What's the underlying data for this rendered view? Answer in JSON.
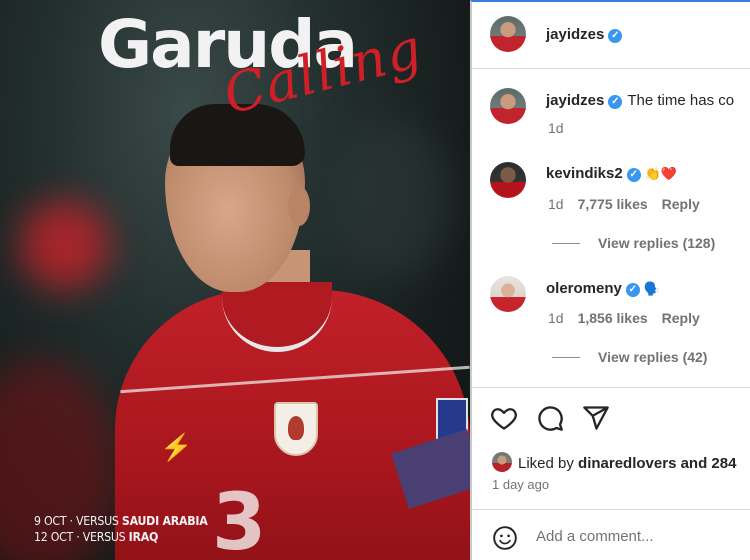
{
  "poster": {
    "title": "Garuda",
    "script": "Calling",
    "shirt_number": "3",
    "fixtures": [
      {
        "date": "9 OCT",
        "prefix": "VERSUS",
        "opponent": "SAUDI ARABIA"
      },
      {
        "date": "12 OCT",
        "prefix": "VERSUS",
        "opponent": "IRAQ"
      }
    ]
  },
  "header": {
    "username": "jayidzes"
  },
  "caption": {
    "username": "jayidzes",
    "text": "The time has co",
    "time": "1d"
  },
  "comments": [
    {
      "username": "kevindiks2",
      "emoji": "👏❤️",
      "time": "1d",
      "likes": "7,775 likes",
      "reply_label": "Reply",
      "view_replies": "View replies (128)"
    },
    {
      "username": "oleromeny",
      "emoji": "🗣️",
      "time": "1d",
      "likes": "1,856 likes",
      "reply_label": "Reply",
      "view_replies": "View replies (42)"
    }
  ],
  "actions": {
    "icons": [
      "heart-icon",
      "comment-icon",
      "share-icon"
    ]
  },
  "likes_line": {
    "prefix": "Liked by",
    "user": "dinaredlovers",
    "suffix": "and 284"
  },
  "post_time": "1 day ago",
  "comment_box": {
    "placeholder": "Add a comment..."
  },
  "colors": {
    "verified": "#3897f0",
    "accent_red": "#d01f26",
    "muted_text": "#737373"
  }
}
